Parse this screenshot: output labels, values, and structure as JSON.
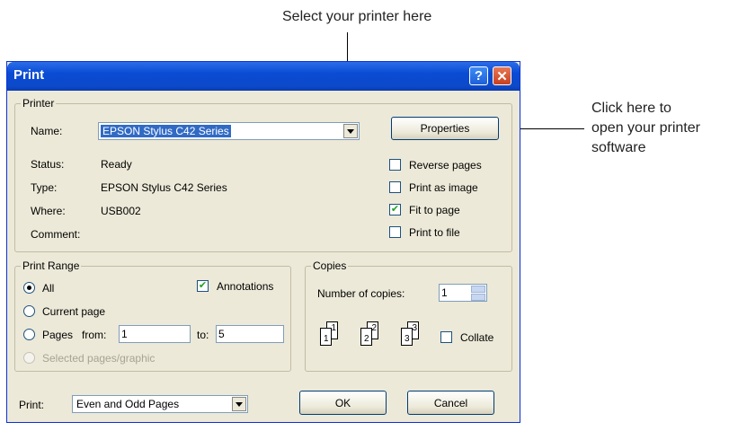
{
  "callouts": {
    "select_printer": "Select your printer here",
    "properties_line1": "Click here to",
    "properties_line2": "open your printer",
    "properties_line3": "software"
  },
  "dialog": {
    "title": "Print",
    "help_glyph": "?",
    "close_glyph": "✕",
    "printer_group": {
      "label": "Printer",
      "name_label": "Name:",
      "name_value": "EPSON Stylus C42 Series",
      "properties_button": "Properties",
      "status_label": "Status:",
      "status_value": "Ready",
      "type_label": "Type:",
      "type_value": "EPSON Stylus C42 Series",
      "where_label": "Where:",
      "where_value": "USB002",
      "comment_label": "Comment:",
      "options": [
        {
          "label": "Reverse pages",
          "checked": false
        },
        {
          "label": "Print as image",
          "checked": false
        },
        {
          "label": "Fit to page",
          "checked": true
        },
        {
          "label": "Print to file",
          "checked": false
        }
      ]
    },
    "print_range": {
      "label": "Print Range",
      "all": "All",
      "current_page": "Current page",
      "pages": "Pages",
      "from_label": "from:",
      "from_value": "1",
      "to_label": "to:",
      "to_value": "5",
      "selected": "Selected pages/graphic",
      "annotations": "Annotations",
      "selected_option": "All"
    },
    "copies": {
      "label": "Copies",
      "number_label": "Number of copies:",
      "number_value": "1",
      "collate": "Collate",
      "collate_checked": false,
      "page_labels": [
        "1",
        "1",
        "2",
        "2",
        "3",
        "3"
      ]
    },
    "bottom": {
      "print_label": "Print:",
      "print_value": "Even and Odd Pages",
      "ok": "OK",
      "cancel": "Cancel"
    }
  },
  "colors": {
    "titlebar": "#0a4bd4",
    "dialog_bg": "#ece9d8",
    "selection": "#316ac5",
    "check": "#21a121"
  }
}
